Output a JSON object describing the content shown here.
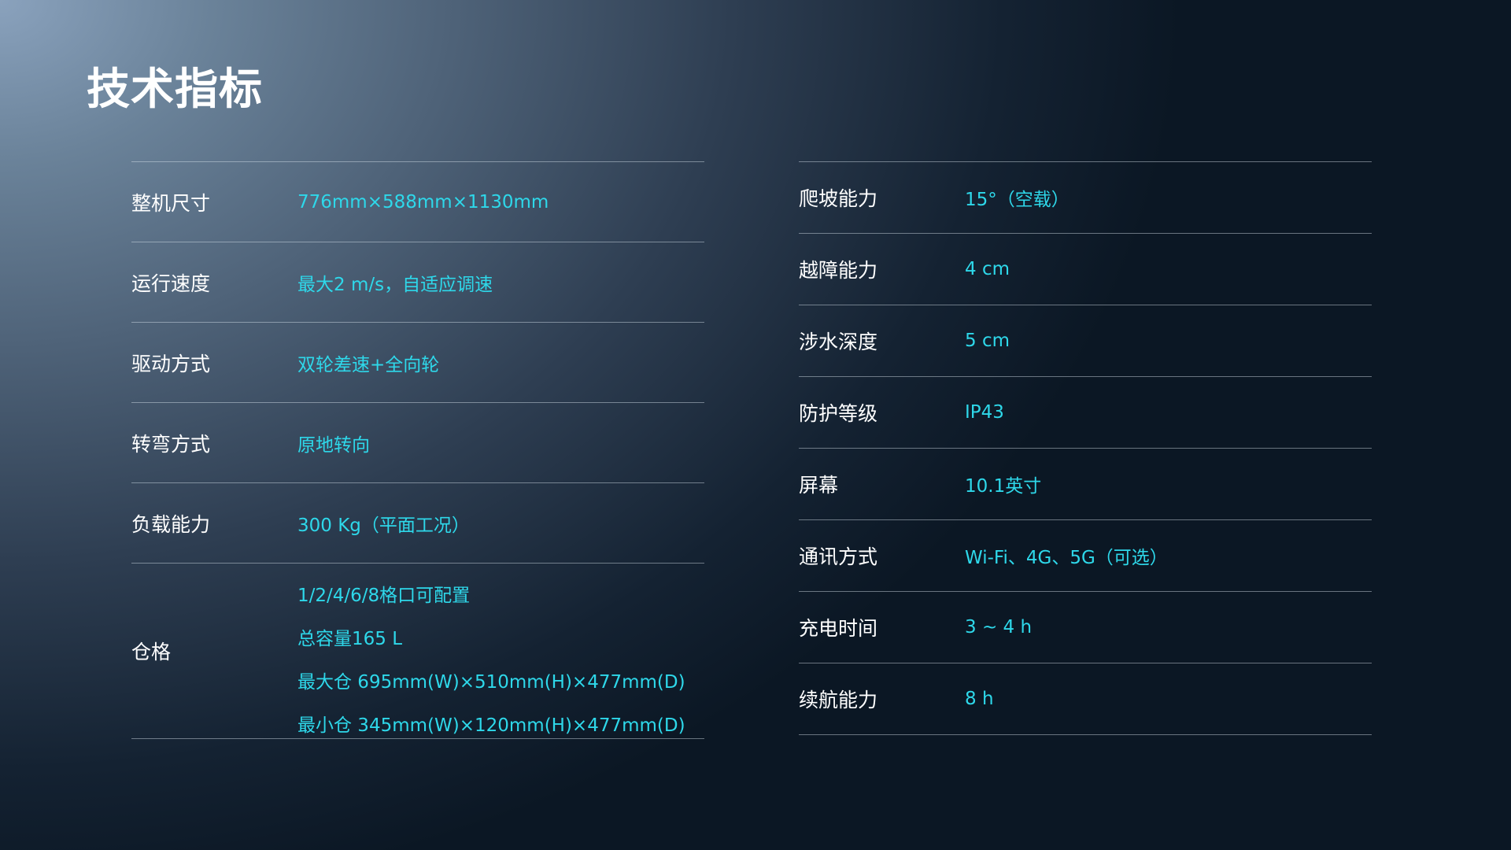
{
  "page": {
    "title": "技术指标"
  },
  "left_specs": [
    {
      "label": "整机尺寸",
      "value": "776mm×588mm×1130mm"
    },
    {
      "label": "运行速度",
      "value": "最大2 m/s，自适应调速"
    },
    {
      "label": "驱动方式",
      "value": "双轮差速+全向轮"
    },
    {
      "label": "转弯方式",
      "value": "原地转向"
    },
    {
      "label": "负载能力",
      "value": "300 Kg（平面工况）"
    }
  ],
  "compartment": {
    "label": "仓格",
    "values": [
      "1/2/4/6/8格口可配置",
      "总容量165 L",
      "最大仓 695mm(W)×510mm(H)×477mm(D)",
      "最小仓 345mm(W)×120mm(H)×477mm(D)"
    ]
  },
  "right_specs": [
    {
      "label": "爬坡能力",
      "value": "15°（空载）"
    },
    {
      "label": "越障能力",
      "value": "4 cm"
    },
    {
      "label": "涉水深度",
      "value": "5 cm"
    },
    {
      "label": "防护等级",
      "value": "IP43"
    },
    {
      "label": "屏幕",
      "value": "10.1英寸"
    },
    {
      "label": "通讯方式",
      "value": "Wi-Fi、4G、5G（可选）"
    },
    {
      "label": "充电时间",
      "value": "3 ~ 4 h"
    },
    {
      "label": "续航能力",
      "value": "8 h"
    }
  ],
  "colors": {
    "label": "#ffffff",
    "value": "#2ed8ea",
    "divider": "rgba(220,230,240,0.45)"
  }
}
